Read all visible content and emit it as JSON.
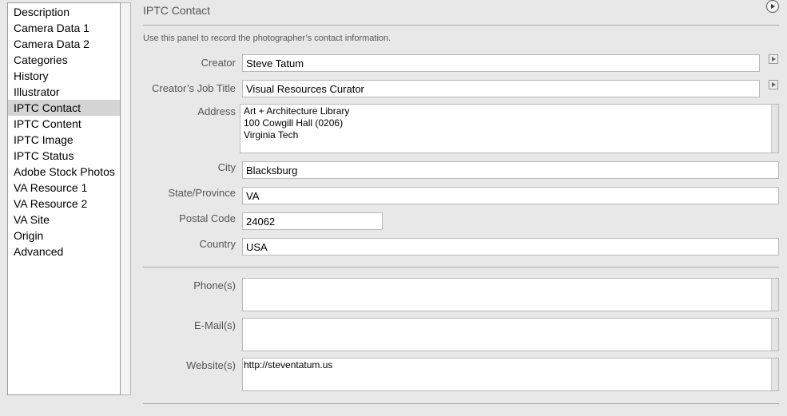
{
  "sidebar": {
    "items": [
      {
        "label": "Description"
      },
      {
        "label": "Camera Data 1"
      },
      {
        "label": "Camera Data 2"
      },
      {
        "label": "Categories"
      },
      {
        "label": "History"
      },
      {
        "label": "Illustrator"
      },
      {
        "label": "IPTC Contact",
        "selected": true
      },
      {
        "label": "IPTC Content"
      },
      {
        "label": "IPTC Image"
      },
      {
        "label": "IPTC Status"
      },
      {
        "label": "Adobe Stock Photos"
      },
      {
        "label": "VA Resource 1"
      },
      {
        "label": "VA Resource 2"
      },
      {
        "label": "VA Site"
      },
      {
        "label": "Origin"
      },
      {
        "label": "Advanced"
      }
    ]
  },
  "panel": {
    "title": "IPTC Contact",
    "help": "Use this panel to record the photographer’s contact information."
  },
  "fields": {
    "creator": {
      "label": "Creator",
      "value": "Steve Tatum"
    },
    "job_title": {
      "label": "Creator’s Job Title",
      "value": "Visual Resources Curator"
    },
    "address": {
      "label": "Address",
      "lines": [
        "Art + Architecture Library",
        "100 Cowgill Hall (0206)",
        "Virginia Tech"
      ]
    },
    "city": {
      "label": "City",
      "value": "Blacksburg"
    },
    "state": {
      "label": "State/Province",
      "value": "VA"
    },
    "postal": {
      "label": "Postal Code",
      "value": "24062"
    },
    "country": {
      "label": "Country",
      "value": "USA"
    },
    "phones": {
      "label": "Phone(s)",
      "value": ""
    },
    "emails": {
      "label": "E-Mail(s)",
      "value": ""
    },
    "websites": {
      "label": "Website(s)",
      "value": "http://steventatum.us"
    }
  },
  "icons": {
    "panel_menu": "circle-play-icon",
    "field_menu": "triangle-right-icon"
  },
  "colors": {
    "background": "#e8e8e8",
    "selected": "#d4d4d4",
    "label": "#555555"
  }
}
